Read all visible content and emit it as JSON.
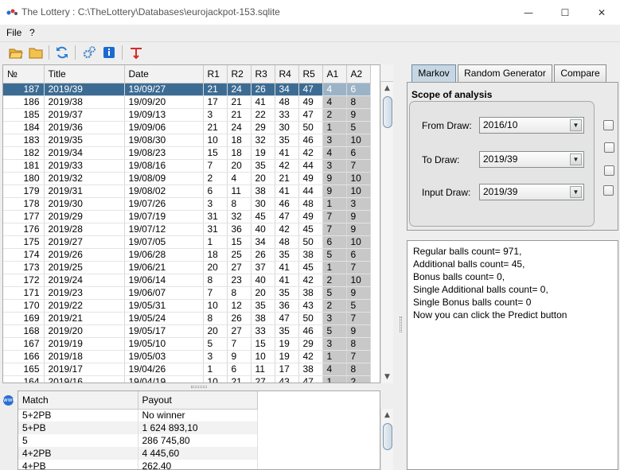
{
  "window": {
    "title": "The Lottery : C:\\TheLottery\\Databases\\eurojackpot-153.sqlite",
    "minimize": "—",
    "maximize": "☐",
    "close": "✕"
  },
  "menu": {
    "file": "File",
    "help": "?"
  },
  "toolbar": {
    "buttons": [
      "open-icon",
      "folder-icon",
      "refresh-icon",
      "settings-icon",
      "info-icon",
      "exit-icon"
    ]
  },
  "draws_table": {
    "columns": [
      "№",
      "Title",
      "Date",
      "R1",
      "R2",
      "R3",
      "R4",
      "R5",
      "A1",
      "A2"
    ],
    "rows": [
      [
        "187",
        "2019/39",
        "19/09/27",
        "21",
        "24",
        "26",
        "34",
        "47",
        "4",
        "6"
      ],
      [
        "186",
        "2019/38",
        "19/09/20",
        "17",
        "21",
        "41",
        "48",
        "49",
        "4",
        "8"
      ],
      [
        "185",
        "2019/37",
        "19/09/13",
        "3",
        "21",
        "22",
        "33",
        "47",
        "2",
        "9"
      ],
      [
        "184",
        "2019/36",
        "19/09/06",
        "21",
        "24",
        "29",
        "30",
        "50",
        "1",
        "5"
      ],
      [
        "183",
        "2019/35",
        "19/08/30",
        "10",
        "18",
        "32",
        "35",
        "46",
        "3",
        "10"
      ],
      [
        "182",
        "2019/34",
        "19/08/23",
        "15",
        "18",
        "19",
        "41",
        "42",
        "4",
        "6"
      ],
      [
        "181",
        "2019/33",
        "19/08/16",
        "7",
        "20",
        "35",
        "42",
        "44",
        "3",
        "7"
      ],
      [
        "180",
        "2019/32",
        "19/08/09",
        "2",
        "4",
        "20",
        "21",
        "49",
        "9",
        "10"
      ],
      [
        "179",
        "2019/31",
        "19/08/02",
        "6",
        "11",
        "38",
        "41",
        "44",
        "9",
        "10"
      ],
      [
        "178",
        "2019/30",
        "19/07/26",
        "3",
        "8",
        "30",
        "46",
        "48",
        "1",
        "3"
      ],
      [
        "177",
        "2019/29",
        "19/07/19",
        "31",
        "32",
        "45",
        "47",
        "49",
        "7",
        "9"
      ],
      [
        "176",
        "2019/28",
        "19/07/12",
        "31",
        "36",
        "40",
        "42",
        "45",
        "7",
        "9"
      ],
      [
        "175",
        "2019/27",
        "19/07/05",
        "1",
        "15",
        "34",
        "48",
        "50",
        "6",
        "10"
      ],
      [
        "174",
        "2019/26",
        "19/06/28",
        "18",
        "25",
        "26",
        "35",
        "38",
        "5",
        "6"
      ],
      [
        "173",
        "2019/25",
        "19/06/21",
        "20",
        "27",
        "37",
        "41",
        "45",
        "1",
        "7"
      ],
      [
        "172",
        "2019/24",
        "19/06/14",
        "8",
        "23",
        "40",
        "41",
        "42",
        "2",
        "10"
      ],
      [
        "171",
        "2019/23",
        "19/06/07",
        "7",
        "8",
        "20",
        "35",
        "38",
        "5",
        "9"
      ],
      [
        "170",
        "2019/22",
        "19/05/31",
        "10",
        "12",
        "35",
        "36",
        "43",
        "2",
        "5"
      ],
      [
        "169",
        "2019/21",
        "19/05/24",
        "8",
        "26",
        "38",
        "47",
        "50",
        "3",
        "7"
      ],
      [
        "168",
        "2019/20",
        "19/05/17",
        "20",
        "27",
        "33",
        "35",
        "46",
        "5",
        "9"
      ],
      [
        "167",
        "2019/19",
        "19/05/10",
        "5",
        "7",
        "15",
        "19",
        "29",
        "3",
        "8"
      ],
      [
        "166",
        "2019/18",
        "19/05/03",
        "3",
        "9",
        "10",
        "19",
        "42",
        "1",
        "7"
      ],
      [
        "165",
        "2019/17",
        "19/04/26",
        "1",
        "6",
        "11",
        "17",
        "38",
        "4",
        "8"
      ],
      [
        "164",
        "2019/16",
        "19/04/19",
        "10",
        "21",
        "27",
        "43",
        "47",
        "1",
        "2"
      ]
    ]
  },
  "payout_table": {
    "columns": [
      "Match",
      "Payout"
    ],
    "rows": [
      [
        "5+2PB",
        "No winner"
      ],
      [
        "5+PB",
        "1 624 893,10"
      ],
      [
        "5",
        "286 745,80"
      ],
      [
        "4+2PB",
        "4 445,60"
      ],
      [
        "4+PB",
        "262,40"
      ]
    ]
  },
  "tabs": [
    "Markov",
    "Random Generator",
    "Compare"
  ],
  "scope": {
    "title": "Scope of analysis",
    "from_label": "From Draw:",
    "from_value": "2016/10",
    "to_label": "To Draw:",
    "to_value": "2019/39",
    "input_label": "Input Draw:",
    "input_value": "2019/39"
  },
  "output_lines": [
    "Regular balls count= 971,",
    "Additional balls count= 45,",
    "Bonus balls count= 0,",
    "Single Additional balls count= 0,",
    "Single Bonus balls count= 0",
    "Now you can click the Predict button"
  ],
  "colors": {
    "selection": "#3c6c94",
    "additional_column": "#c8c8c8",
    "active_tab": "#c7d6e3"
  }
}
